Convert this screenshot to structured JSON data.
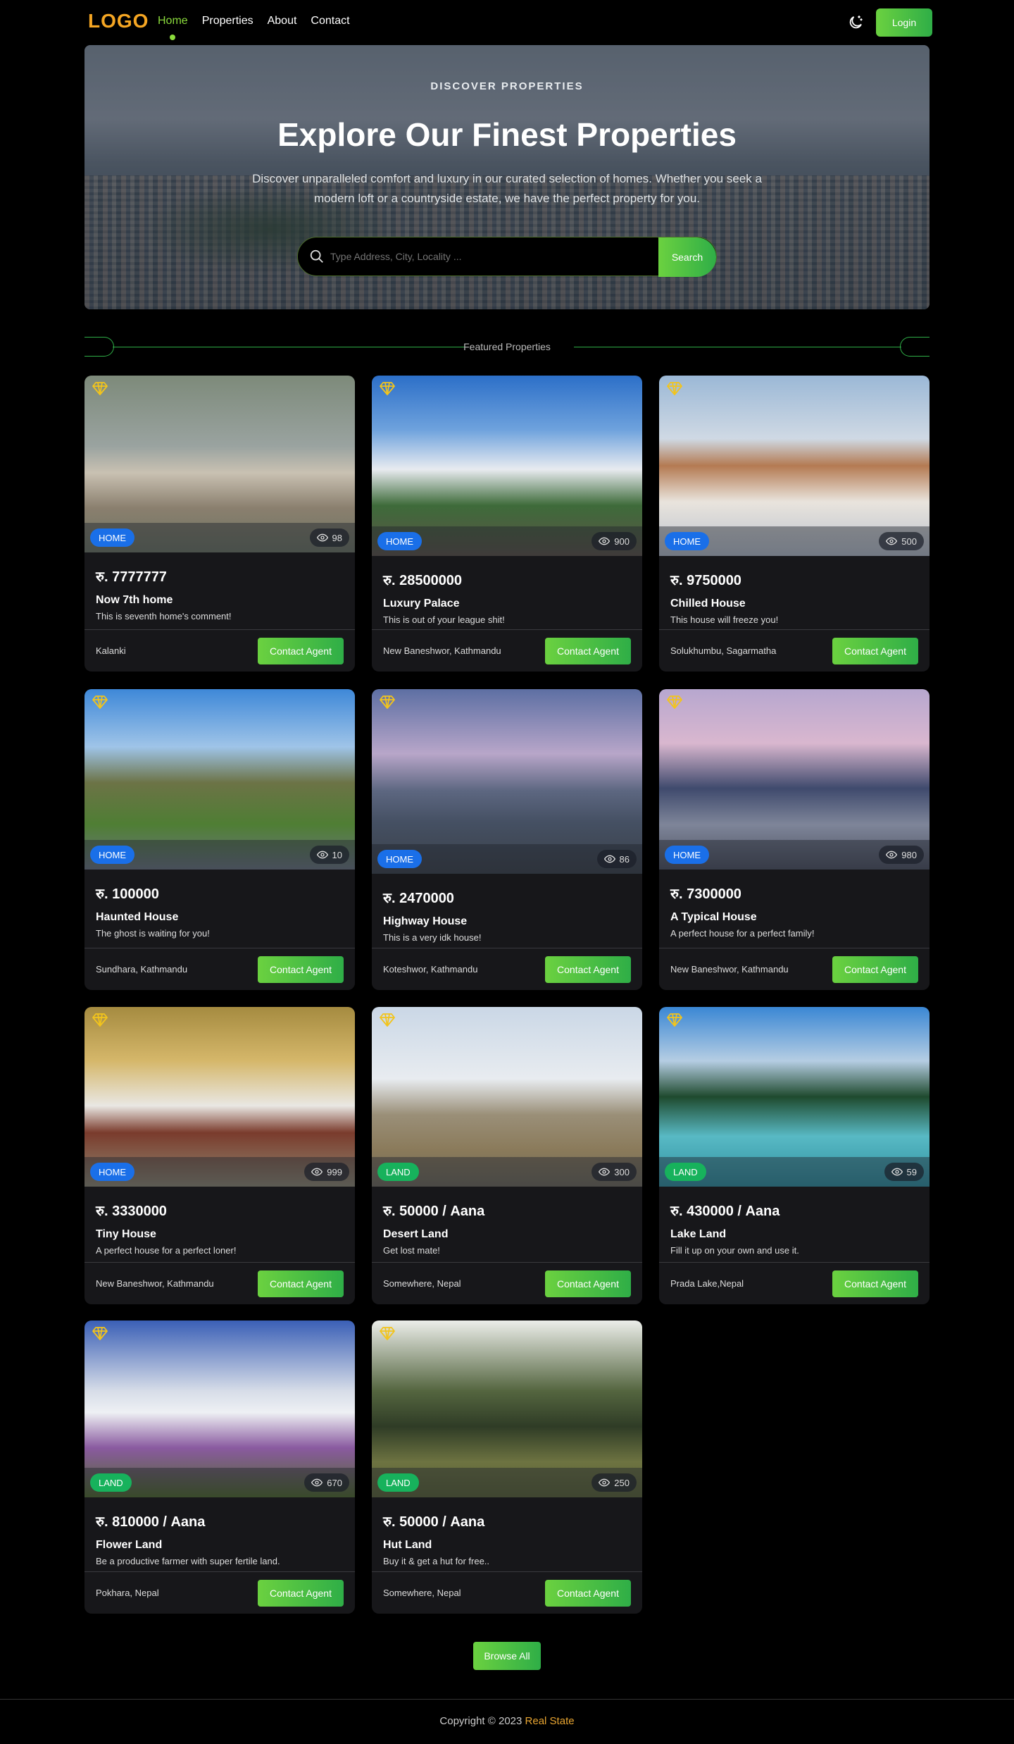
{
  "nav": {
    "logo": "LOGO",
    "links": [
      {
        "label": "Home",
        "active": true
      },
      {
        "label": "Properties",
        "active": false
      },
      {
        "label": "About",
        "active": false
      },
      {
        "label": "Contact",
        "active": false
      }
    ],
    "theme_icon": "moon-sun-icon",
    "login_label": "Login"
  },
  "hero": {
    "kicker": "DISCOVER PROPERTIES",
    "title": "Explore Our Finest Properties",
    "description": "Discover unparalleled comfort and luxury in our curated selection of homes. Whether you seek a modern loft or a countryside estate, we have the perfect property for you.",
    "search_placeholder": "Type Address, City, Locality ...",
    "search_label": "Search"
  },
  "section_title": "Featured Properties",
  "properties": [
    {
      "type": "HOME",
      "views": "98",
      "price": "रु. 7777777",
      "title": "Now 7th home",
      "desc": "This is seventh home's comment!",
      "location": "Kalanki",
      "contact": "Contact Agent"
    },
    {
      "type": "HOME",
      "views": "900",
      "price": "रु. 28500000",
      "title": "Luxury Palace",
      "desc": "This is out of your league shit!",
      "location": "New Baneshwor, Kathmandu",
      "contact": "Contact Agent"
    },
    {
      "type": "HOME",
      "views": "500",
      "price": "रु. 9750000",
      "title": "Chilled House",
      "desc": "This house will freeze you!",
      "location": "Solukhumbu, Sagarmatha",
      "contact": "Contact Agent"
    },
    {
      "type": "HOME",
      "views": "10",
      "price": "रु. 100000",
      "title": "Haunted House",
      "desc": "The ghost is waiting for you!",
      "location": "Sundhara, Kathmandu",
      "contact": "Contact Agent"
    },
    {
      "type": "HOME",
      "views": "86",
      "price": "रु. 2470000",
      "title": "Highway House",
      "desc": "This is a very idk house!",
      "location": "Koteshwor, Kathmandu",
      "contact": "Contact Agent"
    },
    {
      "type": "HOME",
      "views": "980",
      "price": "रु. 7300000",
      "title": "A Typical House",
      "desc": "A perfect house for a perfect family!",
      "location": "New Baneshwor, Kathmandu",
      "contact": "Contact Agent"
    },
    {
      "type": "HOME",
      "views": "999",
      "price": "रु. 3330000",
      "title": "Tiny House",
      "desc": "A perfect house for a perfect loner!",
      "location": "New Baneshwor, Kathmandu",
      "contact": "Contact Agent"
    },
    {
      "type": "LAND",
      "views": "300",
      "price": "रु. 50000 / Aana",
      "title": "Desert Land",
      "desc": "Get lost mate!",
      "location": "Somewhere, Nepal",
      "contact": "Contact Agent"
    },
    {
      "type": "LAND",
      "views": "59",
      "price": "रु. 430000 / Aana",
      "title": "Lake Land",
      "desc": "Fill it up on your own and use it.",
      "location": "Prada Lake,Nepal",
      "contact": "Contact Agent"
    },
    {
      "type": "LAND",
      "views": "670",
      "price": "रु. 810000 / Aana",
      "title": "Flower Land",
      "desc": "Be a productive farmer with super fertile land.",
      "location": "Pokhara, Nepal",
      "contact": "Contact Agent"
    },
    {
      "type": "LAND",
      "views": "250",
      "price": "रु. 50000 / Aana",
      "title": "Hut Land",
      "desc": "Buy it & get a hut for free..",
      "location": "Somewhere, Nepal",
      "contact": "Contact Agent"
    }
  ],
  "browse_label": "Browse All",
  "footer": {
    "text": "Copyright © 2023",
    "brand": "Real State"
  },
  "colors": {
    "accent": "#6bd140",
    "home_badge": "#1a6fe8",
    "land_badge": "#17b25c",
    "logo": "#f5a623"
  }
}
